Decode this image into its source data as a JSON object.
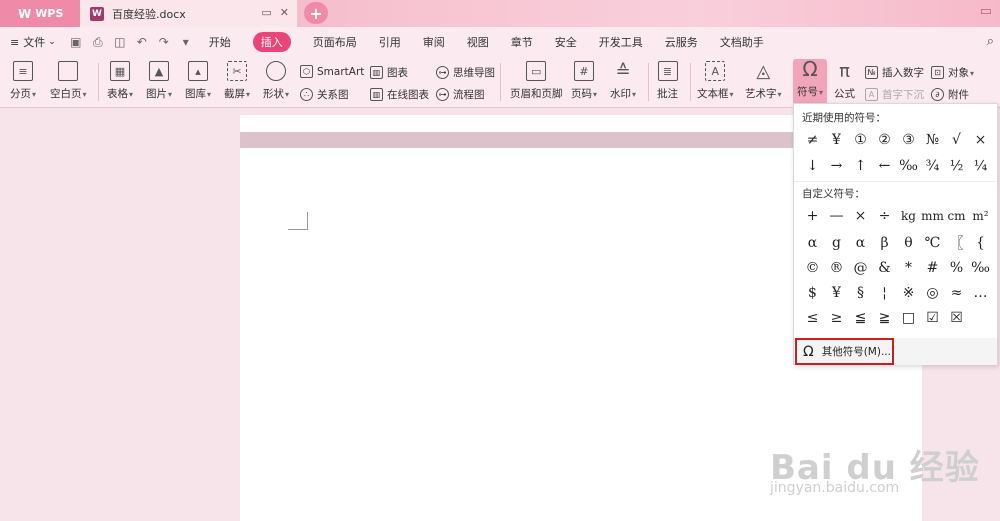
{
  "titlebar": {
    "app_name": "WPS",
    "doc_tab": "百度经验.docx",
    "doc_icon": "W",
    "add_tab": "+",
    "pin": "▭",
    "close": "✕"
  },
  "menubar": {
    "file": "文件",
    "tabs": [
      "开始",
      "插入",
      "页面布局",
      "引用",
      "审阅",
      "视图",
      "章节",
      "安全",
      "开发工具",
      "云服务",
      "文档助手"
    ],
    "active_tab": "插入",
    "search_icon": "🔍"
  },
  "ribbon": {
    "buttons": [
      "分页",
      "空白页",
      "表格",
      "图片",
      "图库",
      "截屏",
      "形状",
      "页眉和页脚",
      "页码",
      "水印",
      "批注",
      "文本框",
      "艺术字",
      "符号",
      "公式"
    ],
    "smartart": "SmartArt",
    "chart": "图表",
    "mindmap": "思维导图",
    "relation": "关系图",
    "online_chart": "在线图表",
    "flowchart": "流程图",
    "insert_number": "插入数字",
    "object": "对象",
    "first_letter": "首字下沉",
    "attachment": "附件"
  },
  "symbol_dropdown": {
    "recent_label": "近期使用的符号：",
    "recent_row1": [
      "≠",
      "¥",
      "①",
      "②",
      "③",
      "№",
      "√",
      "×"
    ],
    "recent_row2": [
      "↓",
      "→",
      "↑",
      "←",
      "‰",
      "¾",
      "½",
      "¼"
    ],
    "custom_label": "自定义符号：",
    "custom_rows": [
      [
        "+",
        "—",
        "×",
        "÷",
        "kg",
        "mm",
        "cm",
        "m²"
      ],
      [
        "α",
        "g",
        "α",
        "β",
        "θ",
        "℃",
        "〖",
        "{"
      ],
      [
        "©",
        "®",
        "@",
        "&",
        "*",
        "#",
        "%",
        "‰"
      ],
      [
        "$",
        "¥",
        "§",
        "¦",
        "※",
        "◎",
        "≈",
        "…"
      ],
      [
        "≤",
        "≥",
        "≦",
        "≧",
        "□",
        "☑",
        "☒",
        ""
      ]
    ],
    "more_symbols": "其他符号(M)...",
    "omega": "Ω"
  },
  "watermark": {
    "text": "Bai du 经验",
    "url": "jingyan.baidu.com"
  },
  "colors": {
    "accent": "#e8467a",
    "highlight": "#c8201e"
  }
}
